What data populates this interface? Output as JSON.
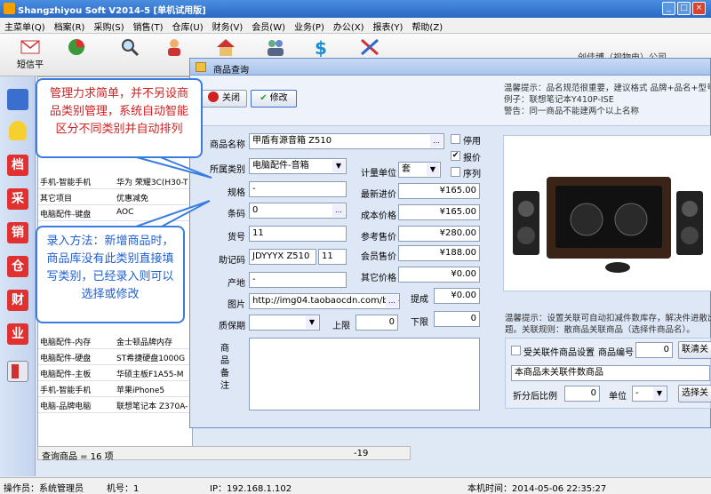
{
  "app": {
    "title": "Shangzhiyou Soft V2014-5 [单机试用版]"
  },
  "menu": [
    "主菜单(Q)",
    "档案(R)",
    "采购(S)",
    "销售(T)",
    "仓库(U)",
    "财务(V)",
    "会员(W)",
    "业务(P)",
    "办公(X)",
    "报表(Y)",
    "帮助(Z)"
  ],
  "toolbar": {
    "sms": "短信平",
    "company": "创佳博（视物电）公司"
  },
  "left_icons": [
    "档",
    "采",
    "销",
    "仓",
    "财",
    "业"
  ],
  "bg_table": {
    "rows": [
      [
        "手机-智能手机",
        "华为 荣耀3C(H30-T"
      ],
      [
        "其它项目",
        "优惠减免"
      ],
      [
        "电脑配件-键盘",
        "AOC"
      ],
      [
        "电脑配件-内存",
        "金士顿品牌内存"
      ],
      [
        "电脑配件-硬盘",
        "ST希捷硬盘1000G"
      ],
      [
        "电脑配件-主板",
        "华硕主板F1A55-M"
      ],
      [
        "手机-智能手机",
        "苹果iPhone5"
      ],
      [
        "电脑-品牌电脑",
        "联想笔记本 Z370A-"
      ]
    ],
    "footer_label": "查询商品 = 16 项",
    "footer_value": "-19"
  },
  "dialog": {
    "title": "商品查询",
    "close_label": "关闭",
    "modify_label": "修改",
    "hint_title": "温馨提示：品名规范很重要，建议格式 品牌+品名+型号",
    "hint_example": "例子：联想笔记本Y410P-ISE",
    "hint_warning": "警告：同一商品不能建两个以上名称",
    "fields": {
      "name_label": "商品名称",
      "name": "甲盾有源音箱 Z510",
      "category_label": "所属类别",
      "category": "电脑配件-音箱",
      "spec_label": "规格",
      "spec": "-",
      "barcode_label": "条码",
      "barcode": "0",
      "item_no_label": "货号",
      "item_no": "11",
      "mnemonic_label": "助记码",
      "mnemonic": "JDYYYX Z510",
      "mnemonic_num": "11",
      "origin_label": "产地",
      "origin": "-",
      "image_label": "图片",
      "image": "http://img04.taobaocdn.com/bao/u",
      "warranty_label": "质保期",
      "upper_label": "上限",
      "upper": "0",
      "lower_label": "下限",
      "lower": "0",
      "remark_label": "商品备注",
      "unit_label": "计量单位",
      "unit": "套",
      "latest_price_label": "最新进价",
      "latest_price": "¥165.00",
      "cost_price_label": "成本价格",
      "cost_price": "¥165.00",
      "ref_price_label": "参考售价",
      "ref_price": "¥280.00",
      "member_price_label": "会员售价",
      "member_price": "¥188.00",
      "other_price_label": "其它价格",
      "other_price": "¥0.00",
      "commission_label": "提成",
      "commission": "¥0.00",
      "disable_label": "停用",
      "quote_label": "报价",
      "serial_label": "序列"
    },
    "link_hint1": "温馨提示：设置关联可自动扣减件数库存，解决件进散出",
    "link_hint2": "题。关联规则：散商品关联商品（选择件商品名）。",
    "link_settings_label": "受关联件商品设置",
    "link_code_label": "商品编号",
    "link_code": "0",
    "link_clear_btn": "联清关",
    "link_product": "本商品未关联件数商品",
    "split_label": "折分后比例",
    "split": "0",
    "split_unit_label": "单位",
    "split_unit": "-",
    "select_btn": "选择关"
  },
  "callouts": {
    "top": "管理力求简单，并不另设商品类别管理，系统自动智能区分不同类别并自动排列",
    "bottom": "录入方法：新增商品时，商品库没有此类别直接填写类别，已经录入则可以选择或修改"
  },
  "status": {
    "operator": "操作员：系统管理员",
    "machine": "机号：1",
    "ip": "IP：192.168.1.102",
    "time": "本机时间：2014-05-06 22:35:27"
  },
  "colors": {
    "accent": "#3a7de0",
    "callout_bg": "#ffffff",
    "title_bar": "#2a68c4"
  }
}
